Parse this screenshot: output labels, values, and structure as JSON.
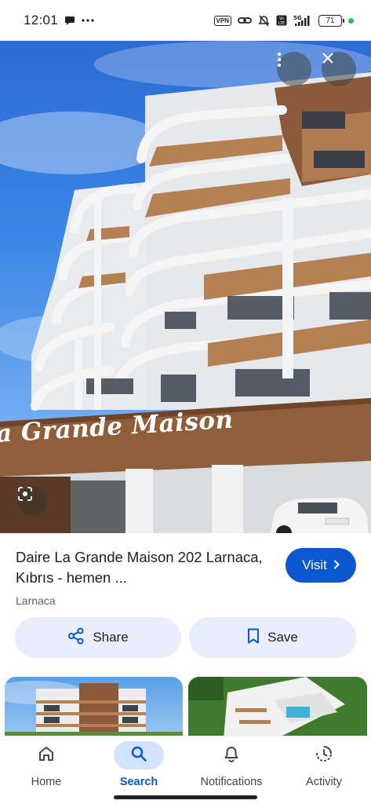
{
  "status_bar": {
    "time": "12:01",
    "battery": "71",
    "network": "5G",
    "vpn": "VPN",
    "volte": "Vo LTE"
  },
  "hero": {
    "sign_text": "a Grande Maison",
    "icons": [
      "more-vert-icon",
      "close-icon",
      "google-lens-icon"
    ]
  },
  "result": {
    "title": "Daire La Grande Maison 202 Larnaca, Kıbrıs - hemen ...",
    "source": "Larnaca",
    "visit_label": "Visit"
  },
  "actions": {
    "share_label": "Share",
    "save_label": "Save"
  },
  "bottom_nav": {
    "items": [
      {
        "label": "Home",
        "icon": "home-icon"
      },
      {
        "label": "Search",
        "icon": "search-icon",
        "active": true
      },
      {
        "label": "Notifications",
        "icon": "bell-icon"
      },
      {
        "label": "Activity",
        "icon": "history-icon"
      }
    ]
  },
  "colors": {
    "accent": "#0b57d0",
    "chip_bg": "#e8eefb",
    "active_pill": "#d3e3fd"
  }
}
